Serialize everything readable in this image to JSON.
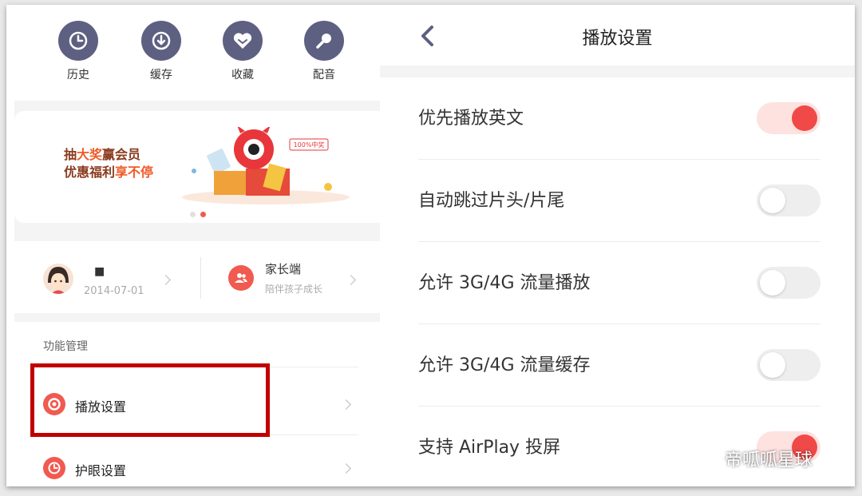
{
  "quick_actions": [
    {
      "label": "历史",
      "icon": "history-clock-icon"
    },
    {
      "label": "缓存",
      "icon": "download-icon"
    },
    {
      "label": "收藏",
      "icon": "heart-icon"
    },
    {
      "label": "配音",
      "icon": "microphone-icon"
    }
  ],
  "banner": {
    "line1_a": "抽",
    "line1_b": "大奖",
    "line1_c": "赢会员",
    "line2_a": "优惠福利",
    "line2_b": "享不停",
    "tag": "100%中奖",
    "page_count": 2,
    "active_page": 2
  },
  "profile": {
    "name": "■",
    "birthdate": "2014-07-01"
  },
  "parent": {
    "title": "家长端",
    "subtitle": "陪伴孩子成长"
  },
  "function_section": {
    "title": "功能管理",
    "items": [
      {
        "label": "播放设置",
        "icon": "play-settings-icon"
      },
      {
        "label": "护眼设置",
        "icon": "eye-care-clock-icon"
      }
    ]
  },
  "settings_page": {
    "title": "播放设置",
    "items": [
      {
        "label": "优先播放英文",
        "enabled": true
      },
      {
        "label": "自动跳过片头/片尾",
        "enabled": false
      },
      {
        "label": "允许 3G/4G 流量播放",
        "enabled": false
      },
      {
        "label": "允许 3G/4G 流量缓存",
        "enabled": false
      },
      {
        "label": "支持 AirPlay 投屏",
        "enabled": true
      }
    ]
  },
  "watermark": "帝呱呱星球",
  "colors": {
    "accent": "#f05a50",
    "icon_bg": "#5e6082",
    "toggle_on_track": "#fde2e0",
    "toggle_on_knob": "#f04a48",
    "highlight_box": "#c00000"
  }
}
